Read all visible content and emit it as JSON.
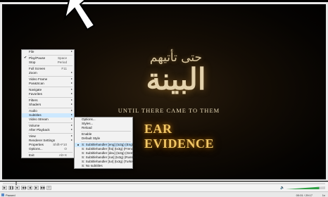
{
  "video": {
    "arabic_line_1": "حتى تأتيهم",
    "arabic_line_2": "البينة",
    "english_line": "UNTIL THERE CAME TO THEM",
    "english_title": "EAR EVIDENCE"
  },
  "main_menu": {
    "items": [
      {
        "label": "File",
        "arrow": true
      },
      {
        "sep": true
      },
      {
        "label": "Play/Pause",
        "shortcut": "Space",
        "check": true
      },
      {
        "label": "Stop",
        "shortcut": "Period"
      },
      {
        "sep": true
      },
      {
        "label": "Full Screen",
        "shortcut": "F11"
      },
      {
        "label": "Zoom",
        "arrow": true
      },
      {
        "sep": true
      },
      {
        "label": "Video Frame",
        "arrow": true
      },
      {
        "label": "Pan&Scan",
        "arrow": true
      },
      {
        "sep": true
      },
      {
        "label": "Navigate",
        "arrow": true
      },
      {
        "label": "Favorites",
        "arrow": true
      },
      {
        "sep": true
      },
      {
        "label": "Filters",
        "arrow": true
      },
      {
        "label": "Shaders",
        "arrow": true
      },
      {
        "sep": true
      },
      {
        "label": "Audio",
        "arrow": true
      },
      {
        "label": "Subtitles",
        "arrow": true,
        "highlight": true
      },
      {
        "label": "Video Stream",
        "arrow": true
      },
      {
        "sep": true
      },
      {
        "label": "Volume",
        "arrow": true
      },
      {
        "label": "After Playback",
        "arrow": true
      },
      {
        "sep": true
      },
      {
        "label": "View",
        "arrow": true
      },
      {
        "label": "Renderer Settings",
        "arrow": true
      },
      {
        "label": "Properties",
        "shortcut": "Shift+F10"
      },
      {
        "label": "Options...",
        "shortcut": "O"
      },
      {
        "sep": true
      },
      {
        "label": "Exit",
        "shortcut": "Alt+X"
      }
    ]
  },
  "sub_menu": {
    "items": [
      {
        "label": "Options..."
      },
      {
        "label": "Styles..."
      },
      {
        "label": "Reload"
      },
      {
        "sep": true
      },
      {
        "label": "Enable"
      },
      {
        "label": "Default Style"
      },
      {
        "sep": true
      },
      {
        "label": "S: Subtitlehandler [eng] (tx3g) (English)",
        "selected": true,
        "highlight": true
      },
      {
        "label": "S: Subtitlehandler [fra] (tx3g) (French)"
      },
      {
        "label": "S: Subtitlehandler [deu] (tx3g) (German)"
      },
      {
        "label": "S: Subtitlehandler [rus] (tx3g) (Russian)"
      },
      {
        "label": "S: Subtitlehandler [tur] (tx3g) (Turkish)"
      },
      {
        "label": "S: No subtitles"
      }
    ]
  },
  "controls": {
    "buttons": [
      "▶",
      "❚❚",
      "■",
      "◀◀",
      "◀",
      "▶",
      "▶▶",
      "≡"
    ],
    "volume_icon": "🔈",
    "volume_fraction": 0.85
  },
  "status": {
    "text": "Paused",
    "time": "00:01 / 29:17",
    "speed": "1x"
  }
}
